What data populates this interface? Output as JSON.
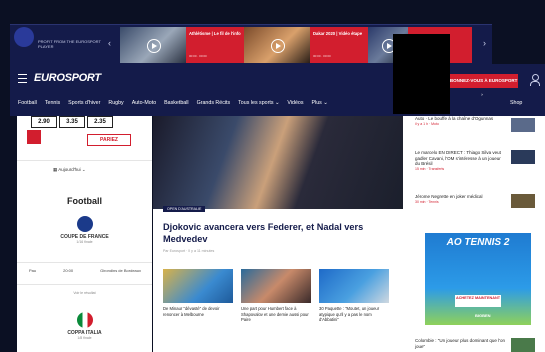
{
  "colors": {
    "brand_navy": "#141b4a",
    "accent_red": "#d21e2e",
    "background": "#0b1023"
  },
  "promo": {
    "left_text": "PROFIT FROM THE EUROSPORT PLAYER",
    "cards": [
      {
        "title": "Athlétisme | Le fil de l'info",
        "meta": "00:00 · 00:00"
      },
      {
        "title": "Dakar 2020 | Vidéo étape",
        "meta": "00:00 · 00:00"
      },
      {
        "title": "",
        "meta": ""
      }
    ]
  },
  "header": {
    "brand": "EUROSPORT",
    "cta": "ABONNEZ-VOUS À EUROSPORT ›",
    "nav": [
      "Football",
      "Tennis",
      "Sports d'hiver",
      "Rugby",
      "Auto-Moto",
      "Basketball",
      "Grands Récits",
      "Tous les sports ⌄",
      "Vidéos",
      "Plus ⌄"
    ],
    "shop": "Shop"
  },
  "left": {
    "odds": [
      "2.90",
      "3.35",
      "2.35"
    ],
    "bet_button": "PARIEZ",
    "date_selector": "Aujourd'hui",
    "section_title": "Football",
    "competitions": [
      {
        "name": "COUPE DE FRANCE",
        "sub": "1/16 finale"
      },
      {
        "name": "COPPA ITALIA",
        "sub": "1/8 finale"
      }
    ],
    "match": {
      "home": "Pau",
      "time": "20:00",
      "away": "Girondins de Bordeaux"
    },
    "note": "Voir le résultat"
  },
  "main": {
    "tag": "OPEN D'AUSTRALIE",
    "headline": "Djokovic avancera vers Federer, et Nadal vers Medvedev",
    "byline": "Par Eurosport · Il y a 11 minutes",
    "minis": [
      {
        "caption": "De Minaur \"dévasté\" de devoir renoncer à Melbourne"
      },
      {
        "caption": "Une part pour Humbert face à Shapovalov et une demie aussi pour Paire"
      },
      {
        "caption": "30 Paquette : \"Moutet, un joueur atypique qu'il y a pas le nom d'Abbatini\""
      }
    ]
  },
  "right": {
    "news": [
      {
        "title": "Auto · Le bouffe à la chaîne d'Ogunnas",
        "meta": "il y a 1 h · Moto"
      },
      {
        "title": "Le marcelo EN DIRECT : Thiago Silva veut gadler Cavani, l'OM s'intéresse à un joueur du Brésil",
        "meta": "15 min · Transferts"
      },
      {
        "title": "Jérome Negrette en joker médical",
        "meta": "30 min · Tennis"
      }
    ],
    "ad": {
      "title": "AO TENNIS 2",
      "button": "ACHETEZ MAINTENANT",
      "brand": "BIGBEN"
    },
    "bottom_news": "Colombie : \"Un joueur plus dominant que l'on joue\""
  }
}
